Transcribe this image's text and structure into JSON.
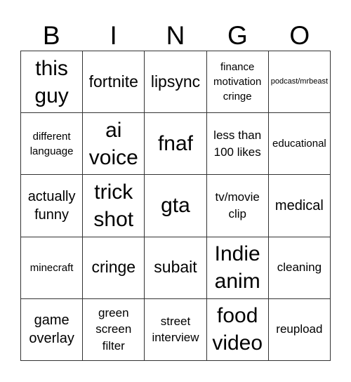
{
  "header": {
    "letters": [
      "B",
      "I",
      "N",
      "G",
      "O"
    ]
  },
  "grid": {
    "rows": [
      [
        {
          "text": "this guy",
          "size": "s-xxl"
        },
        {
          "text": "fortnite",
          "size": "s-xl"
        },
        {
          "text": "lipsync",
          "size": "s-xl"
        },
        {
          "text": "finance motivation cringe",
          "size": "s-s"
        },
        {
          "text": "podcast/mrbeast",
          "size": "s-xs"
        }
      ],
      [
        {
          "text": "different language",
          "size": "s-s"
        },
        {
          "text": "ai voice",
          "size": "s-xxl"
        },
        {
          "text": "fnaf",
          "size": "s-xxl"
        },
        {
          "text": "less than 100 likes",
          "size": "s-m"
        },
        {
          "text": "educational",
          "size": "s-s"
        }
      ],
      [
        {
          "text": "actually funny",
          "size": "s-l"
        },
        {
          "text": "trick shot",
          "size": "s-xxl"
        },
        {
          "text": "gta",
          "size": "s-xxl"
        },
        {
          "text": "tv/movie clip",
          "size": "s-m"
        },
        {
          "text": "medical",
          "size": "s-l"
        }
      ],
      [
        {
          "text": "minecraft",
          "size": "s-s"
        },
        {
          "text": "cringe",
          "size": "s-xl"
        },
        {
          "text": "subait",
          "size": "s-xl"
        },
        {
          "text": "Indie anim",
          "size": "s-xxl"
        },
        {
          "text": "cleaning",
          "size": "s-m"
        }
      ],
      [
        {
          "text": "game overlay",
          "size": "s-l"
        },
        {
          "text": "green screen filter",
          "size": "s-m"
        },
        {
          "text": "street interview",
          "size": "s-m"
        },
        {
          "text": "food video",
          "size": "s-xxl"
        },
        {
          "text": "reupload",
          "size": "s-m"
        }
      ]
    ]
  }
}
